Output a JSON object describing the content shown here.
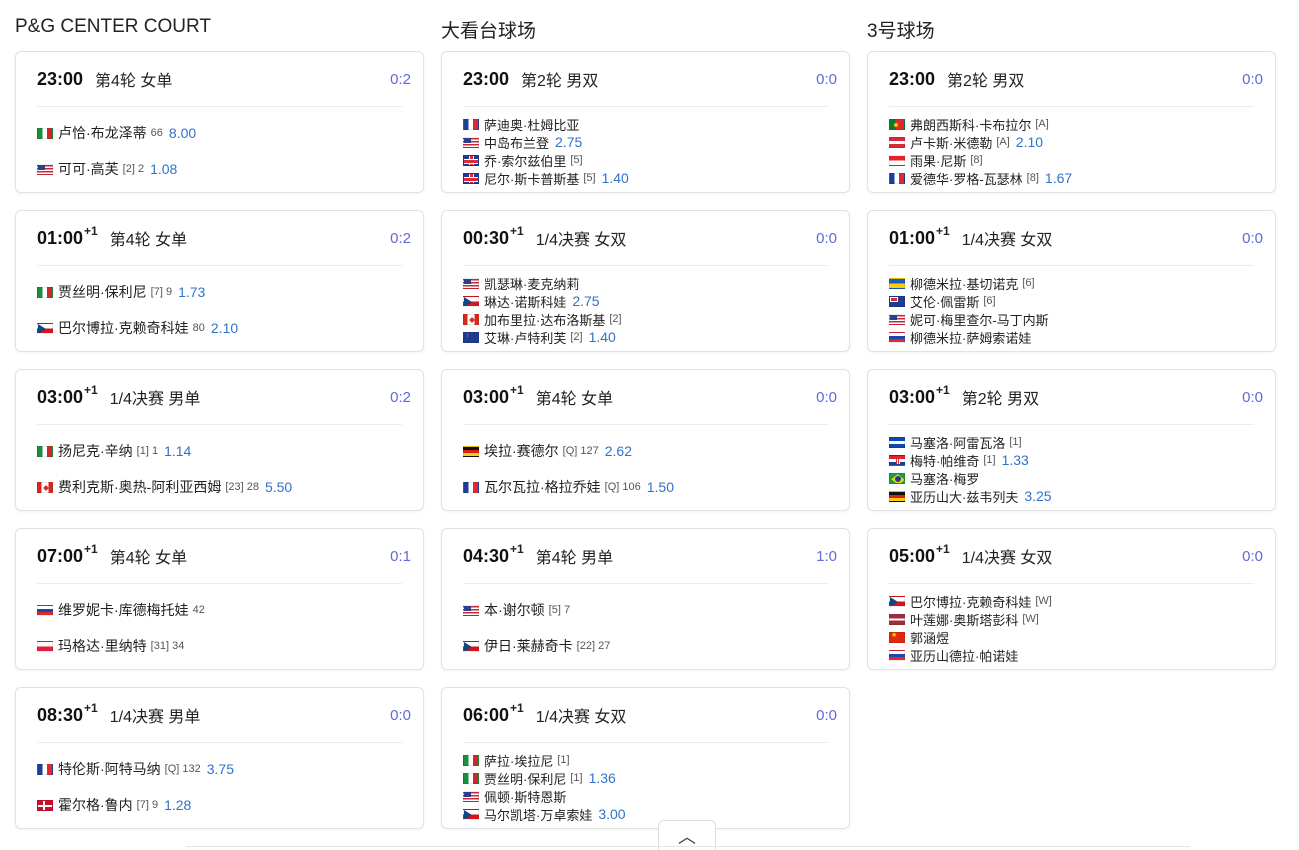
{
  "courts": [
    {
      "name": "P&G CENTER COURT",
      "matches": [
        {
          "time": "23:00",
          "plus": "",
          "round": "第4轮 女单",
          "score": "0:2",
          "doubles": false,
          "players": [
            {
              "flag": "it",
              "name": "卢恰·布龙泽蒂",
              "seed": "66",
              "odds": "8.00"
            },
            {
              "flag": "us",
              "name": "可可·高芙",
              "seed": "[2] 2",
              "odds": "1.08"
            }
          ]
        },
        {
          "time": "01:00",
          "plus": "+1",
          "round": "第4轮 女单",
          "score": "0:2",
          "doubles": false,
          "players": [
            {
              "flag": "it",
              "name": "贾丝明·保利尼",
              "seed": "[7] 9",
              "odds": "1.73"
            },
            {
              "flag": "cz",
              "name": "巴尔博拉·克赖奇科娃",
              "seed": "80",
              "odds": "2.10"
            }
          ]
        },
        {
          "time": "03:00",
          "plus": "+1",
          "round": "1/4决赛 男单",
          "score": "0:2",
          "doubles": false,
          "players": [
            {
              "flag": "it",
              "name": "扬尼克·辛纳",
              "seed": "[1] 1",
              "odds": "1.14"
            },
            {
              "flag": "ca",
              "name": "费利克斯·奥热-阿利亚西姆",
              "seed": "[23] 28",
              "odds": "5.50"
            }
          ]
        },
        {
          "time": "07:00",
          "plus": "+1",
          "round": "第4轮 女单",
          "score": "0:1",
          "doubles": false,
          "players": [
            {
              "flag": "ru",
              "name": "维罗妮卡·库德梅托娃",
              "seed": "42",
              "odds": ""
            },
            {
              "flag": "pl",
              "name": "玛格达·里纳特",
              "seed": "[31] 34",
              "odds": ""
            }
          ]
        },
        {
          "time": "08:30",
          "plus": "+1",
          "round": "1/4决赛 男单",
          "score": "0:0",
          "doubles": false,
          "players": [
            {
              "flag": "fr",
              "name": "特伦斯·阿特马纳",
              "seed": "[Q] 132",
              "odds": "3.75"
            },
            {
              "flag": "dk",
              "name": "霍尔格·鲁内",
              "seed": "[7] 9",
              "odds": "1.28"
            }
          ]
        }
      ]
    },
    {
      "name": "大看台球场",
      "matches": [
        {
          "time": "23:00",
          "plus": "",
          "round": "第2轮 男双",
          "score": "0:0",
          "doubles": true,
          "players": [
            {
              "flag": "fr",
              "name": "萨迪奥·杜姆比亚",
              "seed": "",
              "odds": ""
            },
            {
              "flag": "us",
              "name": "中岛布兰登",
              "seed": "",
              "odds": "2.75"
            },
            {
              "flag": "gb",
              "name": "乔·索尔兹伯里",
              "seed": "[5]",
              "odds": ""
            },
            {
              "flag": "gb",
              "name": "尼尔·斯卡普斯基",
              "seed": "[5]",
              "odds": "1.40"
            }
          ]
        },
        {
          "time": "00:30",
          "plus": "+1",
          "round": "1/4决赛 女双",
          "score": "0:0",
          "doubles": true,
          "players": [
            {
              "flag": "us",
              "name": "凯瑟琳·麦克纳莉",
              "seed": "",
              "odds": ""
            },
            {
              "flag": "cz",
              "name": "琳达·诺斯科娃",
              "seed": "",
              "odds": "2.75"
            },
            {
              "flag": "ca",
              "name": "加布里拉·达布洛斯基",
              "seed": "[2]",
              "odds": ""
            },
            {
              "flag": "nz",
              "name": "艾琳·卢特利芙",
              "seed": "[2]",
              "odds": "1.40"
            }
          ]
        },
        {
          "time": "03:00",
          "plus": "+1",
          "round": "第4轮 女单",
          "score": "0:0",
          "doubles": false,
          "players": [
            {
              "flag": "de",
              "name": "埃拉·赛德尔",
              "seed": "[Q] 127",
              "odds": "2.62"
            },
            {
              "flag": "fr",
              "name": "瓦尔瓦拉·格拉乔娃",
              "seed": "[Q] 106",
              "odds": "1.50"
            }
          ]
        },
        {
          "time": "04:30",
          "plus": "+1",
          "round": "第4轮 男单",
          "score": "1:0",
          "doubles": false,
          "players": [
            {
              "flag": "us",
              "name": "本·谢尔顿",
              "seed": "[5] 7",
              "odds": ""
            },
            {
              "flag": "cz",
              "name": "伊日·莱赫奇卡",
              "seed": "[22] 27",
              "odds": ""
            }
          ]
        },
        {
          "time": "06:00",
          "plus": "+1",
          "round": "1/4决赛 女双",
          "score": "0:0",
          "doubles": true,
          "players": [
            {
              "flag": "it",
              "name": "萨拉·埃拉尼",
              "seed": "[1]",
              "odds": ""
            },
            {
              "flag": "it",
              "name": "贾丝明·保利尼",
              "seed": "[1]",
              "odds": "1.36"
            },
            {
              "flag": "us",
              "name": "佩顿·斯特恩斯",
              "seed": "",
              "odds": ""
            },
            {
              "flag": "cz",
              "name": "马尔凯塔·万卓索娃",
              "seed": "",
              "odds": "3.00"
            }
          ]
        }
      ]
    },
    {
      "name": "3号球场",
      "matches": [
        {
          "time": "23:00",
          "plus": "",
          "round": "第2轮 男双",
          "score": "0:0",
          "doubles": true,
          "players": [
            {
              "flag": "pt",
              "name": "弗朗西斯科·卡布拉尔",
              "seed": "[A]",
              "odds": ""
            },
            {
              "flag": "at",
              "name": "卢卡斯·米德勒",
              "seed": "[A]",
              "odds": "2.10"
            },
            {
              "flag": "mc",
              "name": "雨果·尼斯",
              "seed": "[8]",
              "odds": ""
            },
            {
              "flag": "fr",
              "name": "爱德华·罗格-瓦瑟林",
              "seed": "[8]",
              "odds": "1.67"
            }
          ]
        },
        {
          "time": "01:00",
          "plus": "+1",
          "round": "1/4决赛 女双",
          "score": "0:0",
          "doubles": true,
          "players": [
            {
              "flag": "ua",
              "name": "柳德米拉·基切诺克",
              "seed": "[6]",
              "odds": ""
            },
            {
              "flag": "au",
              "name": "艾伦·佩雷斯",
              "seed": "[6]",
              "odds": ""
            },
            {
              "flag": "us",
              "name": "妮可·梅里查尔-马丁内斯",
              "seed": "",
              "odds": ""
            },
            {
              "flag": "ru",
              "name": "柳德米拉·萨姆索诺娃",
              "seed": "",
              "odds": ""
            }
          ]
        },
        {
          "time": "03:00",
          "plus": "+1",
          "round": "第2轮 男双",
          "score": "0:0",
          "doubles": true,
          "players": [
            {
              "flag": "sv",
              "name": "马塞洛·阿雷瓦洛",
              "seed": "[1]",
              "odds": ""
            },
            {
              "flag": "hr",
              "name": "梅特·帕维奇",
              "seed": "[1]",
              "odds": "1.33"
            },
            {
              "flag": "br",
              "name": "马塞洛·梅罗",
              "seed": "",
              "odds": ""
            },
            {
              "flag": "de",
              "name": "亚历山大·兹韦列夫",
              "seed": "",
              "odds": "3.25"
            }
          ]
        },
        {
          "time": "05:00",
          "plus": "+1",
          "round": "1/4决赛 女双",
          "score": "0:0",
          "doubles": true,
          "players": [
            {
              "flag": "cz",
              "name": "巴尔博拉·克赖奇科娃",
              "seed": "[W]",
              "odds": ""
            },
            {
              "flag": "lv",
              "name": "叶莲娜·奥斯塔彭科",
              "seed": "[W]",
              "odds": ""
            },
            {
              "flag": "cn",
              "name": "郭涵煜",
              "seed": "",
              "odds": ""
            },
            {
              "flag": "ru",
              "name": "亚历山德拉·帕诺娃",
              "seed": "",
              "odds": ""
            }
          ]
        }
      ]
    }
  ],
  "collapse": {
    "icon": "chevron-up-icon",
    "glyph": "︿"
  }
}
